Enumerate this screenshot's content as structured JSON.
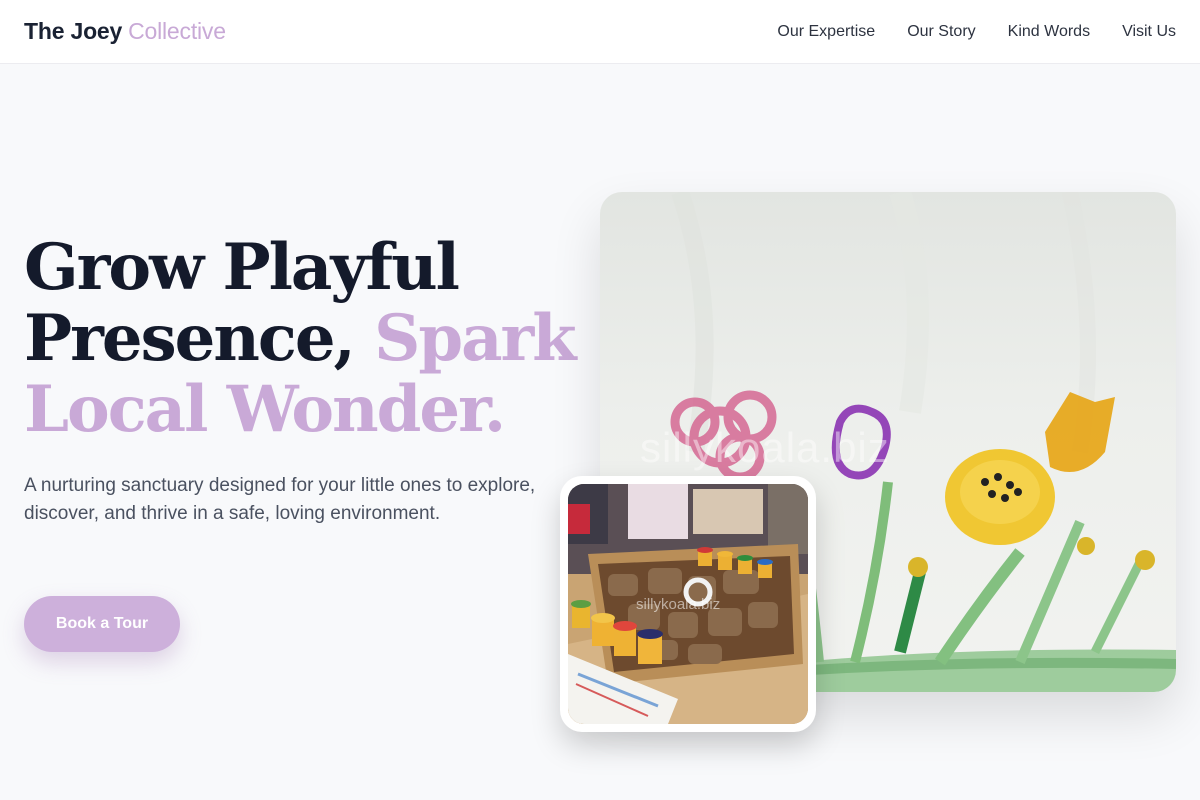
{
  "header": {
    "brand_main": "The Joey",
    "brand_accent": "Collective",
    "nav": [
      {
        "label": "Our Expertise"
      },
      {
        "label": "Our Story"
      },
      {
        "label": "Kind Words"
      },
      {
        "label": "Visit Us"
      }
    ]
  },
  "hero": {
    "title_line1": "Grow Playful",
    "title_line2_dark": "Presence,",
    "title_line2_accent": "Spark",
    "title_line3_accent": "Local Wonder.",
    "subtitle": "A nurturing sanctuary designed for your little ones to explore, discover, and thrive in a safe, loving environment.",
    "cta_label": "Book a Tour"
  },
  "images": {
    "art_watermark": "sillykoala.biz",
    "photo_watermark": "sillykoala.biz"
  },
  "colors": {
    "accent": "#c9a9d7",
    "button": "#cdb0db",
    "heading": "#141a2b",
    "background": "#f8f9fb"
  }
}
